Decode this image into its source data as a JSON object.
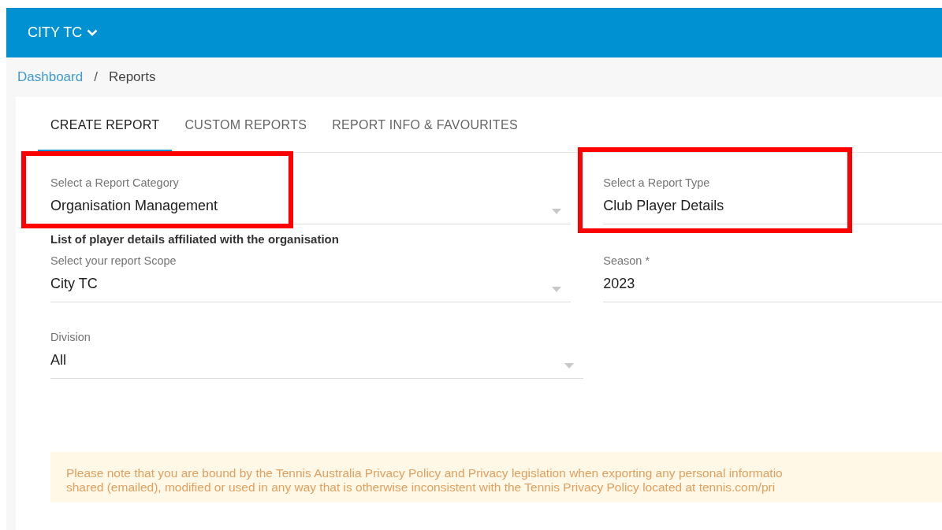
{
  "header": {
    "org": "CITY TC"
  },
  "breadcrumb": [
    {
      "label": "Dashboard",
      "kind": "link"
    },
    {
      "label": "/",
      "kind": "separator"
    },
    {
      "label": "Reports",
      "kind": "current"
    }
  ],
  "tabs": [
    {
      "label": "CREATE REPORT",
      "selected": true
    },
    {
      "label": "CUSTOM REPORTS",
      "selected": false
    },
    {
      "label": "REPORT INFO & FAVOURITES",
      "selected": false
    }
  ],
  "rows": [
    {
      "fields": [
        {
          "label": "Select a Report Category",
          "value": "Organisation Management",
          "dropdown": true,
          "highlighted": true
        },
        {
          "label": "Select a Report Type",
          "value": "Club Player Details",
          "dropdown": false,
          "highlighted": true
        }
      ]
    },
    {
      "description": "List of player details affiliated with the organisation",
      "fields": [
        {
          "label": "Select your report Scope",
          "value": "City TC",
          "dropdown": true,
          "highlighted": false
        },
        {
          "label": "Season *",
          "value": "2023",
          "dropdown": false,
          "highlighted": false
        }
      ]
    },
    {
      "fields": [
        {
          "label": "Division",
          "value": "All",
          "dropdown": true,
          "highlighted": false
        }
      ]
    }
  ],
  "notice": [
    "Please note that you are bound by the Tennis Australia Privacy Policy and Privacy legislation when exporting any personal informatio",
    "shared (emailed), modified or used in any way that is otherwise inconsistent with the Tennis Privacy Policy located at tennis.com/pri"
  ]
}
